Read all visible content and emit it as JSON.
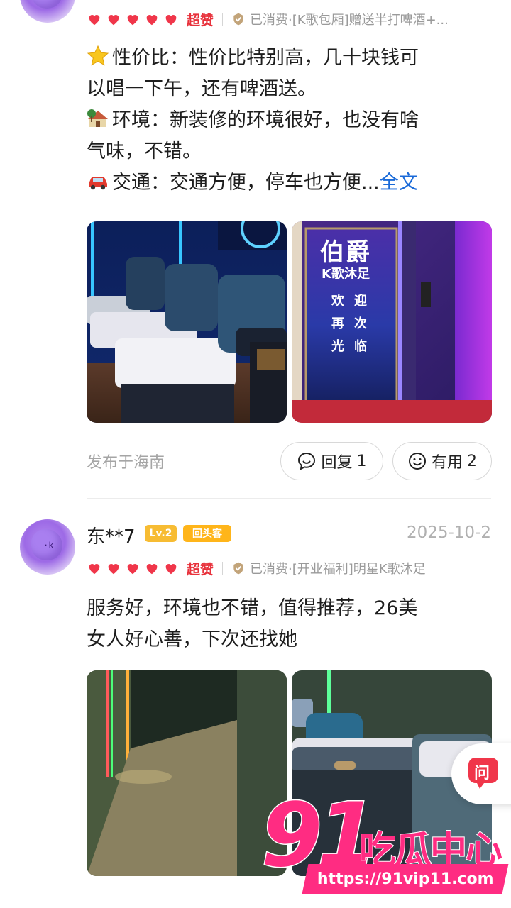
{
  "review1": {
    "rating_text": "超赞",
    "consumed": "已消费·[K歌包厢]赠送半打啤酒+...",
    "lines": [
      {
        "emoji": "star-emoji",
        "label": "性价比：",
        "text": "性价比特别高，几十块钱可"
      },
      {
        "text": "以唱一下午，还有啤酒送。"
      },
      {
        "emoji": "house-emoji",
        "label": "环境：",
        "text": "新装修的环境很好，也没有啥"
      },
      {
        "text": "气味，不错。"
      },
      {
        "emoji": "car-emoji",
        "label": "交通：",
        "text": "交通方便，停车也方便..."
      }
    ],
    "more_link": "全文",
    "photos": [
      "massage-room-photo",
      "entrance-door-photo"
    ],
    "photo2_sign": {
      "title": "伯爵",
      "subtitle": "K歌沐足",
      "welcome": [
        "欢",
        "迎",
        "再",
        "次",
        "光",
        "临"
      ]
    },
    "location": "发布于海南",
    "reply": {
      "label": "回复",
      "count": "1"
    },
    "useful": {
      "label": "有用",
      "count": "2"
    }
  },
  "review2": {
    "username": "东**7",
    "level": "Lv.2",
    "returner_badge": "回头客",
    "date": "2025-10-2",
    "rating_text": "超赞",
    "consumed": "已消费·[开业福利]明星K歌沐足",
    "lines": [
      {
        "text": "服务好，环境也不错，值得推荐，26美"
      },
      {
        "text": "女人好心善，下次还找她"
      }
    ]
  },
  "ask_button": {
    "label": "问"
  },
  "watermark": {
    "number": "91",
    "brand": "吃瓜中心",
    "url": "https://91vip11.com"
  },
  "colors": {
    "accent_red": "#e8313b",
    "link_blue": "#1a6ad8",
    "watermark_pink": "#ff2c82",
    "level_yellow": "#f7bc33"
  }
}
